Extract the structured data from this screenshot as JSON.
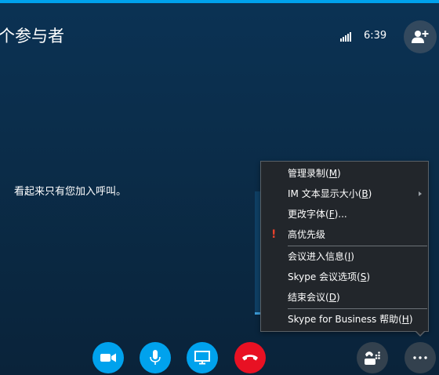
{
  "header": {
    "title": "个参与者",
    "time": "6:39"
  },
  "stage": {
    "message": "看起来只有您加入呼叫。"
  },
  "menu": {
    "items": [
      {
        "label": "管理录制(",
        "mnemonic": "M",
        "suffix": ")"
      },
      {
        "label": "IM 文本显示大小(",
        "mnemonic": "B",
        "suffix": ")"
      },
      {
        "label": "更改字体(",
        "mnemonic": "F",
        "suffix": ")..."
      },
      {
        "label": "高优先级",
        "mnemonic": "",
        "suffix": ""
      },
      {
        "label": "会议进入信息(",
        "mnemonic": "I",
        "suffix": ")"
      },
      {
        "label": "Skype 会议选项(",
        "mnemonic": "S",
        "suffix": ")"
      },
      {
        "label": "结束会议(",
        "mnemonic": "D",
        "suffix": ")"
      },
      {
        "label": "Skype for Business 帮助(",
        "mnemonic": "H",
        "suffix": ")"
      }
    ]
  },
  "colors": {
    "accent": "#00a2ed",
    "hangup": "#e81123",
    "priority": "#e8412c"
  },
  "icons": {
    "signal": "signal-strength-icon",
    "add_participant": "add-person-icon",
    "video": "video-camera-icon",
    "mic": "microphone-icon",
    "present": "monitor-icon",
    "hangup": "hang-up-icon",
    "dialpad": "phone-dialpad-icon",
    "more": "more-options-icon"
  }
}
